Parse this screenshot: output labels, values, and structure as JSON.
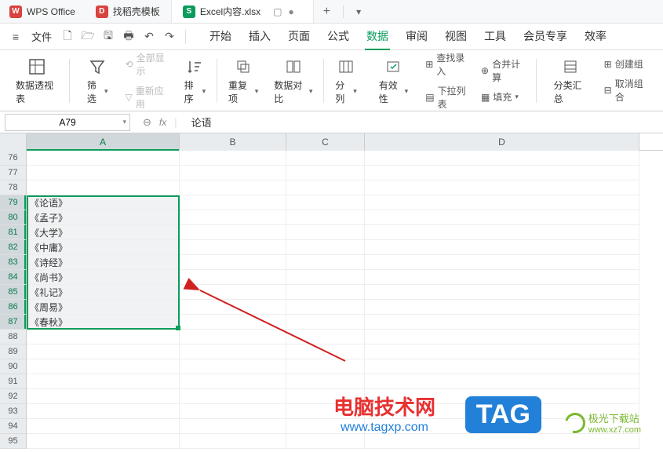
{
  "titlebar": {
    "app_name": "WPS Office",
    "tabs": [
      {
        "icon": "D",
        "label": "找稻壳模板"
      },
      {
        "icon": "S",
        "label": "Excel内容.xlsx",
        "active": true
      }
    ]
  },
  "menubar": {
    "file": "文件",
    "ribbon_tabs": [
      "开始",
      "插入",
      "页面",
      "公式",
      "数据",
      "审阅",
      "视图",
      "工具",
      "会员专享",
      "效率"
    ],
    "active_tab": "数据"
  },
  "ribbon": {
    "pivot": "数据透视表",
    "filter": "筛选",
    "show_all": "全部显示",
    "reapply": "重新应用",
    "sort": "排序",
    "duplicate": "重复项",
    "compare": "数据对比",
    "split": "分列",
    "validate": "有效性",
    "lookup": "查找录入",
    "merge_calc": "合并计算",
    "dropdown": "下拉列表",
    "fill": "填充",
    "subtotal": "分类汇总",
    "group": "创建组",
    "ungroup": "取消组合"
  },
  "formula_bar": {
    "name_box": "A79",
    "value": "论语"
  },
  "columns": [
    "A",
    "B",
    "C",
    "D"
  ],
  "rows": [
    {
      "num": 76,
      "a": ""
    },
    {
      "num": 77,
      "a": ""
    },
    {
      "num": 78,
      "a": ""
    },
    {
      "num": 79,
      "a": "《论语》",
      "sel": true
    },
    {
      "num": 80,
      "a": "《孟子》",
      "sel": true
    },
    {
      "num": 81,
      "a": "《大学》",
      "sel": true
    },
    {
      "num": 82,
      "a": "《中庸》",
      "sel": true
    },
    {
      "num": 83,
      "a": "《诗经》",
      "sel": true
    },
    {
      "num": 84,
      "a": "《尚书》",
      "sel": true
    },
    {
      "num": 85,
      "a": "《礼记》",
      "sel": true
    },
    {
      "num": 86,
      "a": "《周易》",
      "sel": true
    },
    {
      "num": 87,
      "a": "《春秋》",
      "sel": true
    },
    {
      "num": 88,
      "a": ""
    },
    {
      "num": 89,
      "a": ""
    },
    {
      "num": 90,
      "a": ""
    },
    {
      "num": 91,
      "a": ""
    },
    {
      "num": 92,
      "a": ""
    },
    {
      "num": 93,
      "a": ""
    },
    {
      "num": 94,
      "a": ""
    },
    {
      "num": 95,
      "a": ""
    }
  ],
  "watermark": {
    "site1_name": "电脑技术网",
    "site1_url": "www.tagxp.com",
    "tag": "TAG",
    "site2_name": "极光下载站",
    "site2_url": "www.xz7.com"
  }
}
